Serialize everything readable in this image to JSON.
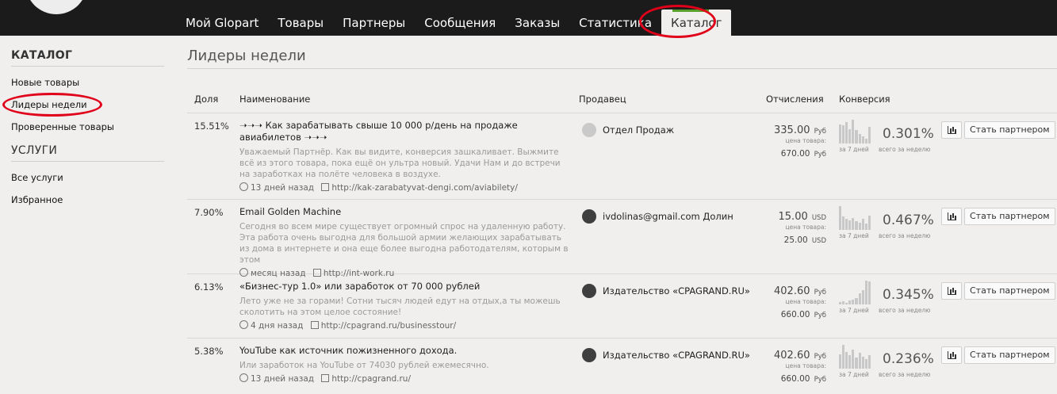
{
  "nav": {
    "items": [
      "Мой Glopart",
      "Товары",
      "Партнеры",
      "Сообщения",
      "Заказы",
      "Статистика",
      "Каталог"
    ],
    "active": "Каталог",
    "accent": "#5aa02c"
  },
  "sidebar": {
    "catalog_title": "КАТАЛОГ",
    "catalog_items": [
      "Новые товары",
      "Лидеры недели",
      "Проверенные товары"
    ],
    "services_title": "УСЛУГИ",
    "services_items": [
      "Все услуги",
      "Избранное"
    ]
  },
  "page": {
    "title": "Лидеры недели"
  },
  "table": {
    "headers": {
      "share": "Доля",
      "name": "Наименование",
      "seller": "Продавец",
      "commission": "Отчисления",
      "conversion": "Конверсия"
    },
    "price_label": "цена товара:",
    "bars_label": "за 7 дней",
    "conv_label": "всего за неделю",
    "partner_button": "Стать партнером",
    "rows": [
      {
        "share": "15.51%",
        "name": "➝➝➝ Как зарабатывать свыше 10 000 р/день на продаже авиабилетов ➝➝➝",
        "desc": "Уважаемый Партнёр. Как вы видите, конверсия зашкаливает. Выжмите всё из этого товара, пока ещё он ультра новый. Удачи Нам и до встречи на заработках на полёте человека в воздухе.",
        "time": "13 дней назад",
        "url": "http://kak-zarabatyvat-dengi.com/aviabilety/",
        "seller": "Отдел Продаж",
        "seller_avatar": "light",
        "commission": "335.00",
        "currency": "Руб",
        "price": "670.00",
        "conversion": "0.301%",
        "bars": [
          80,
          75,
          90,
          60,
          100,
          55,
          40,
          30,
          20,
          70
        ]
      },
      {
        "share": "7.90%",
        "name": "Email Golden Machine",
        "desc": "Сегодня во всем мире существует огромный спрос на удаленную работу. Эта работа очень выгодна для большой армии желающих зарабатывать из дома в интернете и она еще более выгодна работодателям, которым в этом",
        "time": "месяц назад",
        "url": "http://int-work.ru",
        "seller": "ivdolinas@gmail.com Долин",
        "seller_avatar": "dark",
        "commission": "15.00",
        "currency": "USD",
        "price": "25.00",
        "conversion": "0.467%",
        "bars": [
          100,
          55,
          45,
          40,
          50,
          35,
          30,
          45,
          25,
          60
        ]
      },
      {
        "share": "6.13%",
        "name": "«Бизнес-тур 1.0» или заработок от 70 000 рублей",
        "desc": "Лето уже не за горами! Сотни тысяч людей едут на отдых,а ты можешь сколотить на этом целое состояние!",
        "time": "4 дня назад",
        "url": "http://cpagrand.ru/businesstour/",
        "seller": "Издательство «CPAGRAND.RU»",
        "seller_avatar": "dark",
        "commission": "402.60",
        "currency": "Руб",
        "price": "660.00",
        "conversion": "0.345%",
        "bars": [
          10,
          12,
          8,
          15,
          20,
          25,
          45,
          60,
          100,
          95
        ]
      },
      {
        "share": "5.38%",
        "name": "YouTube как источник пожизненного дохода.",
        "desc": "Или заработок на YouTube от 74030 рублей ежемесячно.",
        "time": "13 дней назад",
        "url": "http://cpagrand.ru/",
        "seller": "Издательство «CPAGRAND.RU»",
        "seller_avatar": "dark",
        "commission": "402.60",
        "currency": "Руб",
        "price": "660.00",
        "conversion": "0.236%",
        "bars": [
          60,
          100,
          70,
          55,
          80,
          45,
          65,
          50,
          40,
          55
        ]
      }
    ]
  }
}
